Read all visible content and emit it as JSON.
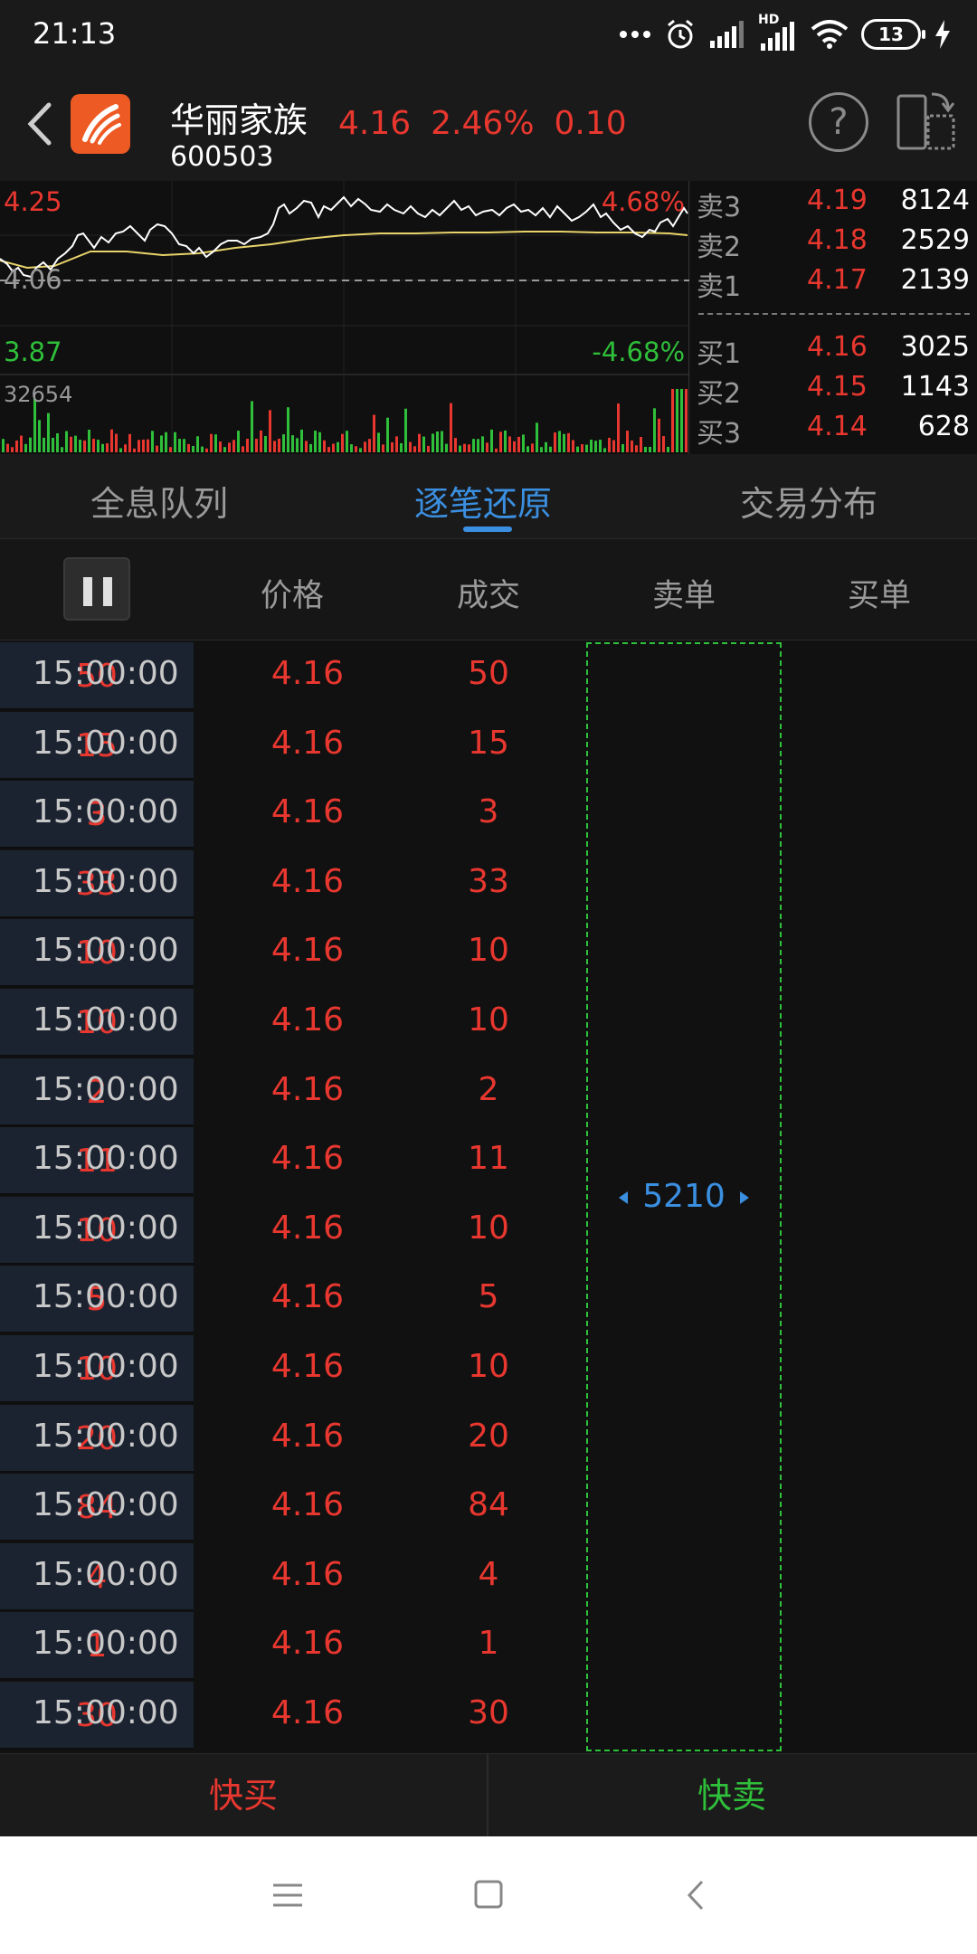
{
  "status_bar": {
    "time": "21:13",
    "battery": "13",
    "signal_tag": "HD"
  },
  "header": {
    "name": "华丽家族",
    "code": "600503",
    "price": "4.16",
    "change_pct": "2.46%",
    "change": "0.10",
    "help": "?"
  },
  "chart": {
    "high_price": "4.25",
    "high_pct": "4.68%",
    "base_price": "4.06",
    "low_price": "3.87",
    "low_pct": "-4.68%",
    "volume_max": "32654"
  },
  "order_book": {
    "asks": [
      {
        "label": "卖3",
        "price": "4.19",
        "volume": "8124"
      },
      {
        "label": "卖2",
        "price": "4.18",
        "volume": "2529"
      },
      {
        "label": "卖1",
        "price": "4.17",
        "volume": "2139"
      }
    ],
    "bids": [
      {
        "label": "买1",
        "price": "4.16",
        "volume": "3025"
      },
      {
        "label": "买2",
        "price": "4.15",
        "volume": "1143"
      },
      {
        "label": "买3",
        "price": "4.14",
        "volume": "628"
      }
    ]
  },
  "tabs": [
    {
      "label": "全息队列"
    },
    {
      "label": "逐笔还原"
    },
    {
      "label": "交易分布"
    }
  ],
  "table": {
    "headers": {
      "price": "价格",
      "volume": "成交",
      "sell": "卖单",
      "buy": "买单"
    },
    "sell_order": "5210",
    "rows": [
      {
        "time": "15:00:00",
        "price": "4.16",
        "volume": "50",
        "buy": "50"
      },
      {
        "time": "15:00:00",
        "price": "4.16",
        "volume": "15",
        "buy": "15"
      },
      {
        "time": "15:00:00",
        "price": "4.16",
        "volume": "3",
        "buy": "3"
      },
      {
        "time": "15:00:00",
        "price": "4.16",
        "volume": "33",
        "buy": "33"
      },
      {
        "time": "15:00:00",
        "price": "4.16",
        "volume": "10",
        "buy": "10"
      },
      {
        "time": "15:00:00",
        "price": "4.16",
        "volume": "10",
        "buy": "10"
      },
      {
        "time": "15:00:00",
        "price": "4.16",
        "volume": "2",
        "buy": "2"
      },
      {
        "time": "15:00:00",
        "price": "4.16",
        "volume": "11",
        "buy": "11"
      },
      {
        "time": "15:00:00",
        "price": "4.16",
        "volume": "10",
        "buy": "10"
      },
      {
        "time": "15:00:00",
        "price": "4.16",
        "volume": "5",
        "buy": "5"
      },
      {
        "time": "15:00:00",
        "price": "4.16",
        "volume": "10",
        "buy": "10"
      },
      {
        "time": "15:00:00",
        "price": "4.16",
        "volume": "20",
        "buy": "20"
      },
      {
        "time": "15:00:00",
        "price": "4.16",
        "volume": "84",
        "buy": "84"
      },
      {
        "time": "15:00:00",
        "price": "4.16",
        "volume": "4",
        "buy": "4"
      },
      {
        "time": "15:00:00",
        "price": "4.16",
        "volume": "1",
        "buy": "1"
      },
      {
        "time": "15:00:00",
        "price": "4.16",
        "volume": "30",
        "buy": "30"
      }
    ]
  },
  "trade": {
    "quick_buy": "快买",
    "quick_sell": "快卖"
  },
  "colors": {
    "up": "#e8372f",
    "down": "#2fbf3a",
    "accent": "#3b8fe0",
    "buy_bg": "#1b2331"
  }
}
